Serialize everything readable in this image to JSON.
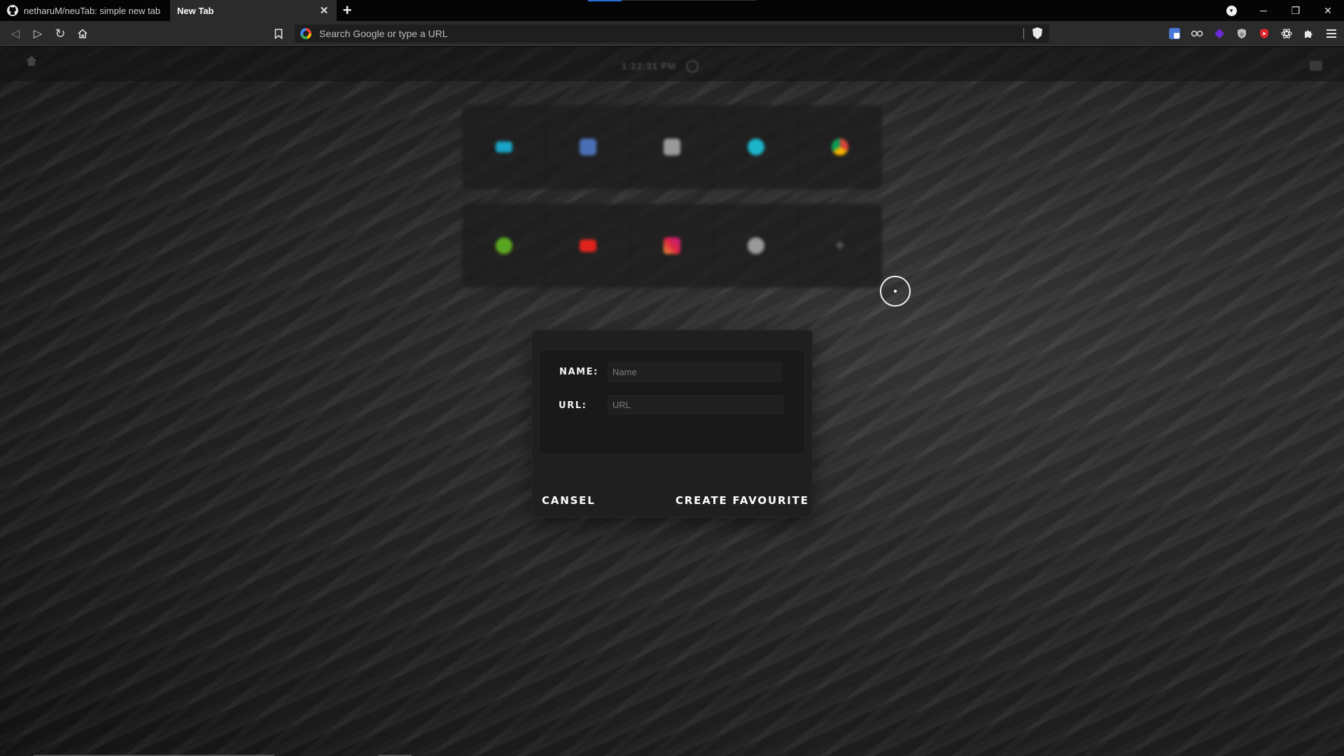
{
  "tabs": [
    {
      "title": "netharuM/neuTab: simple new tab",
      "icon": "github-icon",
      "active": false
    },
    {
      "title": "New Tab",
      "active": true
    }
  ],
  "window_controls": {
    "minimize": "─",
    "restore": "❐",
    "close": "✕"
  },
  "new_tab_label": "+",
  "toolbar": {
    "back": "◁",
    "forward": "▷",
    "reload": "↻",
    "omnibox_placeholder": "Search Google or type a URL"
  },
  "extensions": [
    {
      "name": "translate-icon",
      "color": "#4a78d6"
    },
    {
      "name": "glasses-icon",
      "color": "#cfcfcf"
    },
    {
      "name": "gem-icon",
      "color": "#6a2ad8"
    },
    {
      "name": "shield-icon",
      "color": "#bfbfbf"
    },
    {
      "name": "youtube-ext-icon",
      "color": "#e0242b"
    },
    {
      "name": "atom-icon",
      "color": "#e8e8e8"
    },
    {
      "name": "puzzle-icon",
      "color": "#e8e8e8"
    }
  ],
  "page": {
    "clock": "1:22:31 PM"
  },
  "favourites": {
    "row1": [
      {
        "name": "teal-site-icon",
        "color": "#1aa3c4"
      },
      {
        "name": "blue-site-icon",
        "color": "#4a6fb5"
      },
      {
        "name": "gray-site-icon",
        "color": "#9a9a9a"
      },
      {
        "name": "cyan-site-icon",
        "color": "#1bb6c9"
      },
      {
        "name": "chrome-icon",
        "color": "#e0a03a"
      }
    ],
    "row2": [
      {
        "name": "xbox-icon",
        "color": "#5aa51f"
      },
      {
        "name": "youtube-icon",
        "color": "#e0241d"
      },
      {
        "name": "instagram-icon",
        "color": "#c1357d"
      },
      {
        "name": "github-icon",
        "color": "#aaaaaa"
      },
      {
        "name": "add-icon",
        "plus": "+"
      }
    ]
  },
  "dialog": {
    "name_label": "NAME:",
    "name_placeholder": "Name",
    "url_label": "URL:",
    "url_placeholder": "URL",
    "cancel_label": "CANSEL",
    "create_label": "CREATE FAVOURITE"
  }
}
